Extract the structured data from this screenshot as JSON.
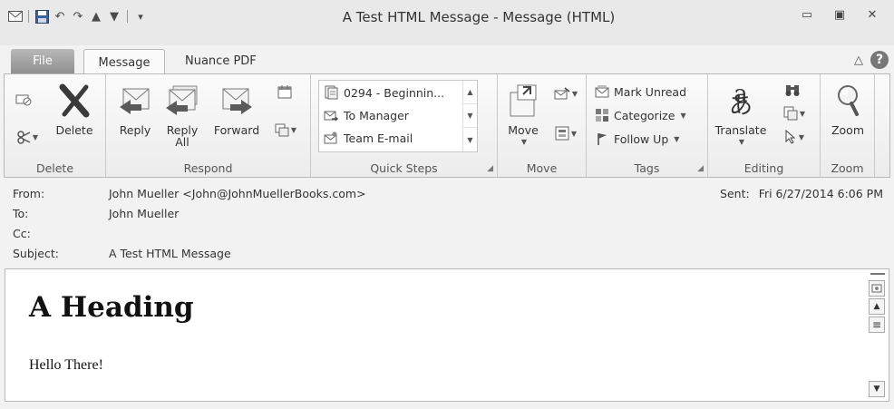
{
  "window": {
    "title": "A Test HTML Message  -  Message (HTML)"
  },
  "qat": {
    "icons": [
      "envelope-icon",
      "save-icon",
      "undo-icon",
      "redo-icon",
      "up-arrow-icon",
      "down-arrow-icon",
      "customize-icon"
    ]
  },
  "tabs": [
    {
      "label": "File"
    },
    {
      "label": "Message"
    },
    {
      "label": "Nuance PDF"
    }
  ],
  "ribbon": {
    "delete_group": {
      "label": "Delete",
      "delete_label": "Delete"
    },
    "respond_group": {
      "label": "Respond",
      "reply": "Reply",
      "reply_all_line1": "Reply",
      "reply_all_line2": "All",
      "forward": "Forward"
    },
    "quick_steps": {
      "label": "Quick Steps",
      "items": [
        "0294 - Beginnin...",
        "To Manager",
        "Team E-mail"
      ]
    },
    "move_group": {
      "label": "Move",
      "move": "Move"
    },
    "tags_group": {
      "label": "Tags",
      "mark_unread": "Mark Unread",
      "categorize": "Categorize",
      "follow_up": "Follow Up"
    },
    "editing_group": {
      "label": "Editing",
      "translate": "Translate"
    },
    "zoom_group": {
      "label": "Zoom",
      "zoom": "Zoom"
    }
  },
  "header": {
    "from_label": "From:",
    "from_value": "John Mueller <John@JohnMuellerBooks.com>",
    "to_label": "To:",
    "to_value": "John Mueller",
    "cc_label": "Cc:",
    "cc_value": "",
    "subject_label": "Subject:",
    "subject_value": "A Test HTML Message",
    "sent_label": "Sent:",
    "sent_value": "Fri 6/27/2014 6:06 PM"
  },
  "body": {
    "heading": "A Heading",
    "paragraph": "Hello There!"
  }
}
